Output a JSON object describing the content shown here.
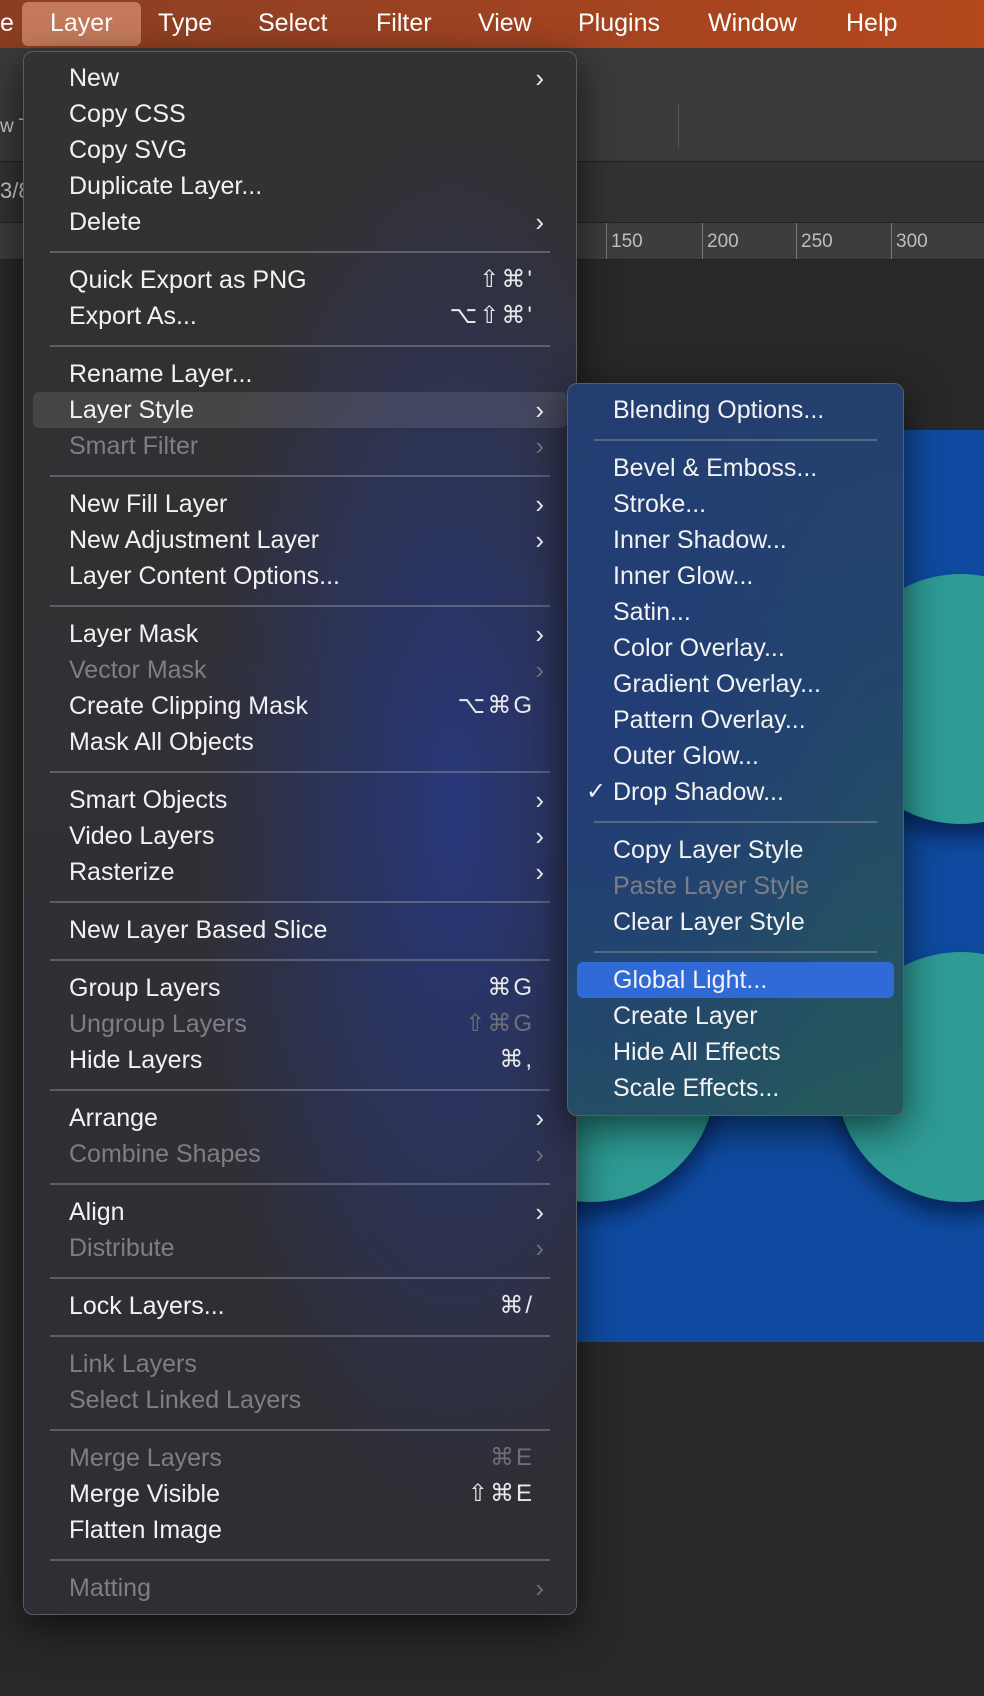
{
  "menubar": {
    "items": [
      {
        "label": "e"
      },
      {
        "label": "Layer"
      },
      {
        "label": "Type"
      },
      {
        "label": "Select"
      },
      {
        "label": "Filter"
      },
      {
        "label": "View"
      },
      {
        "label": "Plugins"
      },
      {
        "label": "Window"
      },
      {
        "label": "Help"
      }
    ]
  },
  "background": {
    "toolbar_clip_text": "w T",
    "options_clip_text": "3/8",
    "ruler_labels": [
      "150",
      "200",
      "250",
      "300"
    ]
  },
  "layer_menu": {
    "items": [
      {
        "label": "New",
        "submenu": true
      },
      {
        "label": "Copy CSS"
      },
      {
        "label": "Copy SVG"
      },
      {
        "label": "Duplicate Layer..."
      },
      {
        "label": "Delete",
        "submenu": true
      },
      {
        "label": "Quick Export as PNG",
        "shortcut": "⇧⌘'"
      },
      {
        "label": "Export As...",
        "shortcut": "⌥⇧⌘'"
      },
      {
        "label": "Rename Layer..."
      },
      {
        "label": "Layer Style",
        "submenu": true,
        "highlighted": true
      },
      {
        "label": "Smart Filter",
        "submenu": true,
        "disabled": true
      },
      {
        "label": "New Fill Layer",
        "submenu": true
      },
      {
        "label": "New Adjustment Layer",
        "submenu": true
      },
      {
        "label": "Layer Content Options..."
      },
      {
        "label": "Layer Mask",
        "submenu": true
      },
      {
        "label": "Vector Mask",
        "submenu": true,
        "disabled": true
      },
      {
        "label": "Create Clipping Mask",
        "shortcut": "⌥⌘G"
      },
      {
        "label": "Mask All Objects"
      },
      {
        "label": "Smart Objects",
        "submenu": true
      },
      {
        "label": "Video Layers",
        "submenu": true
      },
      {
        "label": "Rasterize",
        "submenu": true
      },
      {
        "label": "New Layer Based Slice"
      },
      {
        "label": "Group Layers",
        "shortcut": "⌘G"
      },
      {
        "label": "Ungroup Layers",
        "shortcut": "⇧⌘G",
        "disabled": true
      },
      {
        "label": "Hide Layers",
        "shortcut": "⌘,"
      },
      {
        "label": "Arrange",
        "submenu": true
      },
      {
        "label": "Combine Shapes",
        "submenu": true,
        "disabled": true
      },
      {
        "label": "Align",
        "submenu": true
      },
      {
        "label": "Distribute",
        "submenu": true,
        "disabled": true
      },
      {
        "label": "Lock Layers...",
        "shortcut": "⌘/"
      },
      {
        "label": "Link Layers",
        "disabled": true
      },
      {
        "label": "Select Linked Layers",
        "disabled": true
      },
      {
        "label": "Merge Layers",
        "shortcut": "⌘E",
        "disabled": true
      },
      {
        "label": "Merge Visible",
        "shortcut": "⇧⌘E"
      },
      {
        "label": "Flatten Image"
      },
      {
        "label": "Matting",
        "submenu": true,
        "disabled": true
      }
    ]
  },
  "layer_style_menu": {
    "items": [
      {
        "label": "Blending Options..."
      },
      {
        "label": "Bevel & Emboss..."
      },
      {
        "label": "Stroke..."
      },
      {
        "label": "Inner Shadow..."
      },
      {
        "label": "Inner Glow..."
      },
      {
        "label": "Satin..."
      },
      {
        "label": "Color Overlay..."
      },
      {
        "label": "Gradient Overlay..."
      },
      {
        "label": "Pattern Overlay..."
      },
      {
        "label": "Outer Glow..."
      },
      {
        "label": "Drop Shadow...",
        "checked": true,
        "check_mark": "✓"
      },
      {
        "label": "Copy Layer Style"
      },
      {
        "label": "Paste Layer Style",
        "disabled": true
      },
      {
        "label": "Clear Layer Style"
      },
      {
        "label": "Global Light...",
        "highlighted": true
      },
      {
        "label": "Create Layer"
      },
      {
        "label": "Hide All Effects"
      },
      {
        "label": "Scale Effects..."
      }
    ]
  },
  "arrow_glyph": "›",
  "colors": {
    "menubar": "#9b4222",
    "highlight": "#2f6ad6",
    "canvas": "#0f4ba0",
    "shape": "#2e9b94"
  }
}
